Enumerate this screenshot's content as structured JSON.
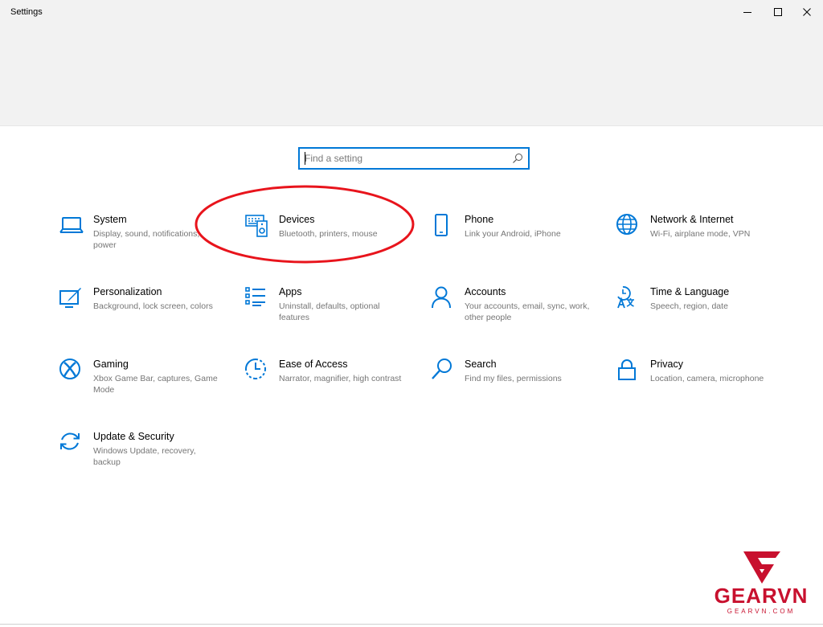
{
  "window": {
    "title": "Settings",
    "controls": [
      {
        "name": "minimize",
        "icon": "minimize-icon"
      },
      {
        "name": "maximize",
        "icon": "maximize-icon"
      },
      {
        "name": "close",
        "icon": "close-icon"
      }
    ]
  },
  "search": {
    "placeholder": "Find a setting",
    "value": "",
    "icon": "search-icon"
  },
  "accent_color": "#0078d7",
  "highlight_color": "#e8141c",
  "categories": [
    {
      "id": "system",
      "title": "System",
      "description": "Display, sound, notifications, power",
      "icon": "laptop-icon"
    },
    {
      "id": "devices",
      "title": "Devices",
      "description": "Bluetooth, printers, mouse",
      "icon": "devices-icon",
      "highlighted": true
    },
    {
      "id": "phone",
      "title": "Phone",
      "description": "Link your Android, iPhone",
      "icon": "phone-icon"
    },
    {
      "id": "network",
      "title": "Network & Internet",
      "description": "Wi-Fi, airplane mode, VPN",
      "icon": "globe-icon"
    },
    {
      "id": "personalization",
      "title": "Personalization",
      "description": "Background, lock screen, colors",
      "icon": "personalization-icon"
    },
    {
      "id": "apps",
      "title": "Apps",
      "description": "Uninstall, defaults, optional features",
      "icon": "apps-list-icon"
    },
    {
      "id": "accounts",
      "title": "Accounts",
      "description": "Your accounts, email, sync, work, other people",
      "icon": "person-icon"
    },
    {
      "id": "time-language",
      "title": "Time & Language",
      "description": "Speech, region, date",
      "icon": "time-language-icon"
    },
    {
      "id": "gaming",
      "title": "Gaming",
      "description": "Xbox Game Bar, captures, Game Mode",
      "icon": "xbox-icon"
    },
    {
      "id": "ease-of-access",
      "title": "Ease of Access",
      "description": "Narrator, magnifier, high contrast",
      "icon": "ease-of-access-icon"
    },
    {
      "id": "search",
      "title": "Search",
      "description": "Find my files, permissions",
      "icon": "magnifier-icon"
    },
    {
      "id": "privacy",
      "title": "Privacy",
      "description": "Location, camera, microphone",
      "icon": "lock-icon"
    },
    {
      "id": "update-security",
      "title": "Update & Security",
      "description": "Windows Update, recovery, backup",
      "icon": "sync-icon"
    }
  ],
  "watermark": {
    "brand": "GEARVN",
    "url": "GEARVN.COM",
    "color": "#c8102e"
  }
}
